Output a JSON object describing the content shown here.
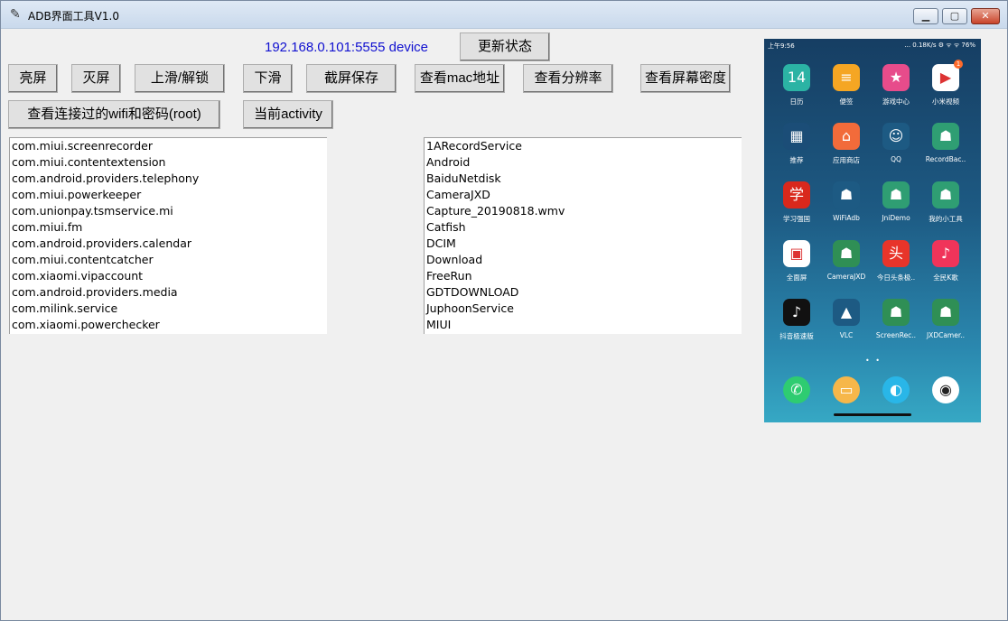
{
  "window": {
    "title": "ADB界面工具V1.0",
    "controls": {
      "minimize": "▁",
      "maximize": "▢",
      "close": "✕"
    }
  },
  "device": {
    "address": "192.168.0.101:5555",
    "state": "device"
  },
  "buttons": {
    "refresh": "更新状态",
    "screen_on": "亮屏",
    "screen_off": "灭屏",
    "swipe_up_unlock": "上滑/解锁",
    "swipe_down": "下滑",
    "screenshot_save": "截屏保存",
    "view_mac": "查看mac地址",
    "view_resolution": "查看分辨率",
    "view_density": "查看屏幕密度",
    "view_wifi_passwords": "查看连接过的wifi和密码(root)",
    "current_activity": "当前activity"
  },
  "packages": [
    "com.miui.screenrecorder",
    "com.miui.contentextension",
    "com.android.providers.telephony",
    "com.miui.powerkeeper",
    "com.unionpay.tsmservice.mi",
    "com.miui.fm",
    "com.android.providers.calendar",
    "com.miui.contentcatcher",
    "com.xiaomi.vipaccount",
    "com.android.providers.media",
    "com.milink.service",
    "com.xiaomi.powerchecker"
  ],
  "files": [
    "1ARecordService",
    "Android",
    "BaiduNetdisk",
    "CameraJXD",
    "Capture_20190818.wmv",
    "Catfish",
    "DCIM",
    "Download",
    "FreeRun",
    "GDTDOWNLOAD",
    "JuphoonService",
    "MIUI"
  ],
  "phone": {
    "status_time": "上午9:56",
    "status_right": "... 0.18K/s ⚙ ᯤ ᯤ 76%",
    "calendar_day": "14",
    "apps": [
      {
        "label": "日历",
        "icon": "calendar-icon",
        "color": "#2bb3a4",
        "glyph": "14"
      },
      {
        "label": "便签",
        "icon": "notes-icon",
        "color": "#f5a623",
        "glyph": "≡"
      },
      {
        "label": "游戏中心",
        "icon": "game-center-icon",
        "color": "#e74c8b",
        "glyph": "★"
      },
      {
        "label": "小米视频",
        "icon": "video-icon",
        "color": "#ffffff",
        "glyph": "▶",
        "badge": "1"
      },
      {
        "label": "推荐",
        "icon": "recommend-icon",
        "color": "#1b4d77",
        "glyph": "▦"
      },
      {
        "label": "应用商店",
        "icon": "app-store-icon",
        "color": "#f26b3a",
        "glyph": "⌂"
      },
      {
        "label": "QQ",
        "icon": "qq-icon",
        "color": "#1d5a83",
        "glyph": "☺"
      },
      {
        "label": "RecordBac..",
        "icon": "android-icon",
        "color": "#2f9e73",
        "glyph": "☗"
      },
      {
        "label": "学习强国",
        "icon": "xuexi-icon",
        "color": "#d9281c",
        "glyph": "学"
      },
      {
        "label": "WiFiAdb",
        "icon": "android-icon",
        "color": "#1d5a83",
        "glyph": "☗"
      },
      {
        "label": "JniDemo",
        "icon": "android-icon",
        "color": "#2f9e73",
        "glyph": "☗"
      },
      {
        "label": "我的小工具",
        "icon": "android-icon",
        "color": "#2f9e73",
        "glyph": "☗"
      },
      {
        "label": "全面屏",
        "icon": "fullscreen-icon",
        "color": "#ffffff",
        "glyph": "▣"
      },
      {
        "label": "CameraJXD",
        "icon": "android-icon",
        "color": "#2f8f55",
        "glyph": "☗"
      },
      {
        "label": "今日头条极..",
        "icon": "toutiao-icon",
        "color": "#e8342a",
        "glyph": "头"
      },
      {
        "label": "全民K歌",
        "icon": "karaoke-icon",
        "color": "#f0345a",
        "glyph": "♪"
      },
      {
        "label": "抖音极速版",
        "icon": "douyin-icon",
        "color": "#111111",
        "glyph": "♪"
      },
      {
        "label": "VLC",
        "icon": "vlc-icon",
        "color": "#1d5a83",
        "glyph": "▲"
      },
      {
        "label": "ScreenRec..",
        "icon": "android-icon",
        "color": "#2f8f55",
        "glyph": "☗"
      },
      {
        "label": "JXDCamer..",
        "icon": "android-icon",
        "color": "#2f8f55",
        "glyph": "☗"
      }
    ],
    "dock": [
      {
        "icon": "phone-icon",
        "color": "#2ecc71",
        "glyph": "✆"
      },
      {
        "icon": "messages-icon",
        "color": "#f6b74a",
        "glyph": "▭"
      },
      {
        "icon": "browser-icon",
        "color": "#29b6e8",
        "glyph": "◐"
      },
      {
        "icon": "camera-icon",
        "color": "#ffffff",
        "glyph": "◉"
      }
    ]
  }
}
